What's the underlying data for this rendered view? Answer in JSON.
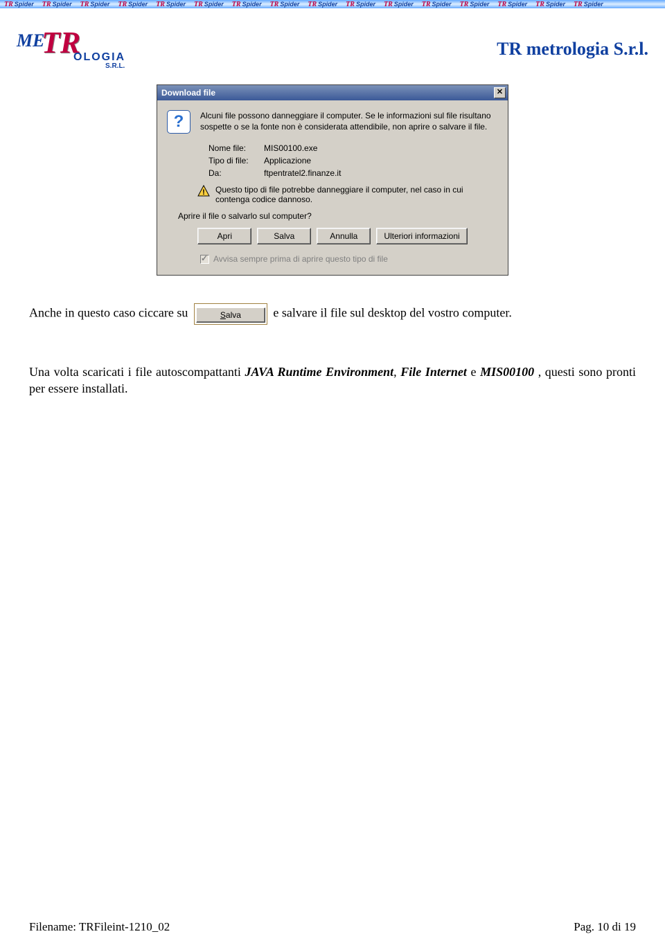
{
  "header": {
    "spider_label": "Spider",
    "spider_prefix": "TR",
    "repeat": 16
  },
  "logo": {
    "me": "ME",
    "tr": "TR",
    "ologia": "OLOGIA",
    "srl": "S.R.L."
  },
  "company_title": "TR metrologia S.r.l.",
  "dialog": {
    "title": "Download file",
    "close": "✕",
    "message": "Alcuni file possono danneggiare il computer. Se le informazioni sul file risultano sospette o se la fonte non è considerata attendibile, non aprire o salvare il file.",
    "file_name_label": "Nome file:",
    "file_name_value": "MIS00100.exe",
    "file_type_label": "Tipo di file:",
    "file_type_value": "Applicazione",
    "from_label": "Da:",
    "from_value": "ftpentratel2.finanze.it",
    "warning": "Questo tipo di file potrebbe danneggiare il computer, nel caso in cui contenga codice dannoso.",
    "prompt": "Aprire il file o salvarlo sul computer?",
    "buttons": {
      "open": "Apri",
      "save": "Salva",
      "cancel": "Annulla",
      "more": "Ulteriori informazioni"
    },
    "checkbox_label": "Avvisa sempre prima di aprire questo tipo di file"
  },
  "inline_button": {
    "prefix": "S",
    "rest": "alva"
  },
  "body": {
    "p1_before": "Anche in questo caso ciccare su ",
    "p1_after": " e salvare il file sul desktop del vostro computer.",
    "p2_a": "Una volta scaricati i file autoscompattanti ",
    "p2_b": "JAVA Runtime Environment",
    "p2_c": ", ",
    "p2_d": "File Internet",
    "p2_e": " e ",
    "p2_f": "MIS00100",
    "p2_g": " , questi sono pronti per essere installati."
  },
  "footer": {
    "filename_label": "Filename: TRFileint-1210_02",
    "page_label": "Pag. 10 di 19"
  }
}
